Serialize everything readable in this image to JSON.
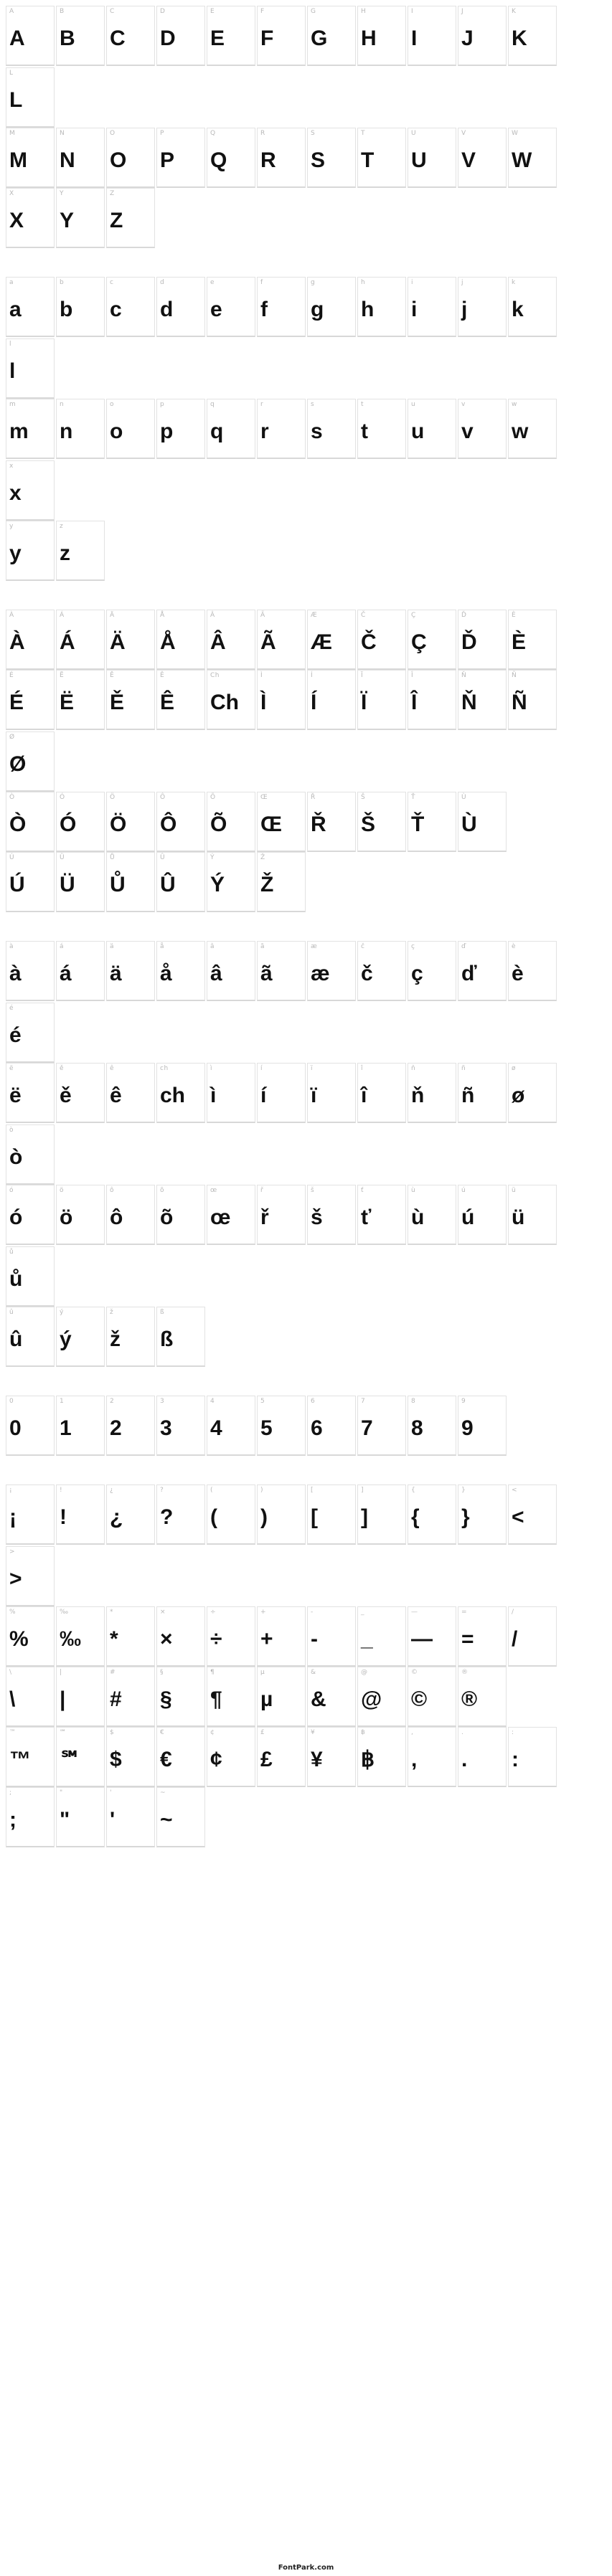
{
  "footer": "FontPark.com",
  "sections": [
    {
      "rows": [
        [
          {
            "lbl": "A",
            "glyph": "A"
          },
          {
            "lbl": "B",
            "glyph": "B"
          },
          {
            "lbl": "C",
            "glyph": "C"
          },
          {
            "lbl": "D",
            "glyph": "D"
          },
          {
            "lbl": "E",
            "glyph": "E"
          },
          {
            "lbl": "F",
            "glyph": "F"
          },
          {
            "lbl": "G",
            "glyph": "G"
          },
          {
            "lbl": "H",
            "glyph": "H"
          },
          {
            "lbl": "I",
            "glyph": "I"
          },
          {
            "lbl": "J",
            "glyph": "J"
          },
          {
            "lbl": "K",
            "glyph": "K"
          },
          {
            "lbl": "L",
            "glyph": "L"
          }
        ],
        [
          {
            "lbl": "M",
            "glyph": "M"
          },
          {
            "lbl": "N",
            "glyph": "N"
          },
          {
            "lbl": "O",
            "glyph": "O"
          },
          {
            "lbl": "P",
            "glyph": "P"
          },
          {
            "lbl": "Q",
            "glyph": "Q"
          },
          {
            "lbl": "R",
            "glyph": "R"
          },
          {
            "lbl": "S",
            "glyph": "S"
          },
          {
            "lbl": "T",
            "glyph": "T"
          },
          {
            "lbl": "U",
            "glyph": "U"
          },
          {
            "lbl": "V",
            "glyph": "V"
          },
          {
            "lbl": "W",
            "glyph": "W"
          }
        ],
        [
          {
            "lbl": "X",
            "glyph": "X"
          },
          {
            "lbl": "Y",
            "glyph": "Y"
          },
          {
            "lbl": "Z",
            "glyph": "Z"
          }
        ]
      ]
    },
    {
      "rows": [
        [
          {
            "lbl": "a",
            "glyph": "a"
          },
          {
            "lbl": "b",
            "glyph": "b"
          },
          {
            "lbl": "c",
            "glyph": "c"
          },
          {
            "lbl": "d",
            "glyph": "d"
          },
          {
            "lbl": "e",
            "glyph": "e"
          },
          {
            "lbl": "f",
            "glyph": "f"
          },
          {
            "lbl": "g",
            "glyph": "g"
          },
          {
            "lbl": "h",
            "glyph": "h"
          },
          {
            "lbl": "i",
            "glyph": "i"
          },
          {
            "lbl": "j",
            "glyph": "j"
          },
          {
            "lbl": "k",
            "glyph": "k"
          },
          {
            "lbl": "l",
            "glyph": "l"
          }
        ],
        [
          {
            "lbl": "m",
            "glyph": "m"
          },
          {
            "lbl": "n",
            "glyph": "n"
          },
          {
            "lbl": "o",
            "glyph": "o"
          },
          {
            "lbl": "p",
            "glyph": "p"
          },
          {
            "lbl": "q",
            "glyph": "q"
          },
          {
            "lbl": "r",
            "glyph": "r"
          },
          {
            "lbl": "s",
            "glyph": "s"
          },
          {
            "lbl": "t",
            "glyph": "t"
          },
          {
            "lbl": "u",
            "glyph": "u"
          },
          {
            "lbl": "v",
            "glyph": "v"
          },
          {
            "lbl": "w",
            "glyph": "w"
          },
          {
            "lbl": "x",
            "glyph": "x"
          }
        ],
        [
          {
            "lbl": "y",
            "glyph": "y"
          },
          {
            "lbl": "z",
            "glyph": "z"
          }
        ]
      ]
    },
    {
      "rows": [
        [
          {
            "lbl": "À",
            "glyph": "À"
          },
          {
            "lbl": "Á",
            "glyph": "Á"
          },
          {
            "lbl": "Ä",
            "glyph": "Ä"
          },
          {
            "lbl": "Å",
            "glyph": "Å"
          },
          {
            "lbl": "Â",
            "glyph": "Â"
          },
          {
            "lbl": "Ã",
            "glyph": "Ã"
          },
          {
            "lbl": "Æ",
            "glyph": "Æ"
          },
          {
            "lbl": "Č",
            "glyph": "Č"
          },
          {
            "lbl": "Ç",
            "glyph": "Ç"
          },
          {
            "lbl": "Ď",
            "glyph": "Ď"
          },
          {
            "lbl": "È",
            "glyph": "È"
          }
        ],
        [
          {
            "lbl": "É",
            "glyph": "É"
          },
          {
            "lbl": "Ë",
            "glyph": "Ë"
          },
          {
            "lbl": "Ě",
            "glyph": "Ě"
          },
          {
            "lbl": "Ê",
            "glyph": "Ê"
          },
          {
            "lbl": "Ch",
            "glyph": "Ch"
          },
          {
            "lbl": "Ì",
            "glyph": "Ì"
          },
          {
            "lbl": "Í",
            "glyph": "Í"
          },
          {
            "lbl": "Ï",
            "glyph": "Ï"
          },
          {
            "lbl": "Î",
            "glyph": "Î"
          },
          {
            "lbl": "Ň",
            "glyph": "Ň"
          },
          {
            "lbl": "Ñ",
            "glyph": "Ñ"
          },
          {
            "lbl": "Ø",
            "glyph": "Ø"
          }
        ],
        [
          {
            "lbl": "Ò",
            "glyph": "Ò"
          },
          {
            "lbl": "Ó",
            "glyph": "Ó"
          },
          {
            "lbl": "Ö",
            "glyph": "Ö"
          },
          {
            "lbl": "Ô",
            "glyph": "Ô"
          },
          {
            "lbl": "Õ",
            "glyph": "Õ"
          },
          {
            "lbl": "Œ",
            "glyph": "Œ"
          },
          {
            "lbl": "Ř",
            "glyph": "Ř"
          },
          {
            "lbl": "Š",
            "glyph": "Š"
          },
          {
            "lbl": "Ť",
            "glyph": "Ť"
          },
          {
            "lbl": "Ù",
            "glyph": "Ù"
          }
        ],
        [
          {
            "lbl": "Ú",
            "glyph": "Ú"
          },
          {
            "lbl": "Ü",
            "glyph": "Ü"
          },
          {
            "lbl": "Ů",
            "glyph": "Ů"
          },
          {
            "lbl": "Û",
            "glyph": "Û"
          },
          {
            "lbl": "Ý",
            "glyph": "Ý"
          },
          {
            "lbl": "Ž",
            "glyph": "Ž"
          }
        ]
      ]
    },
    {
      "rows": [
        [
          {
            "lbl": "à",
            "glyph": "à"
          },
          {
            "lbl": "á",
            "glyph": "á"
          },
          {
            "lbl": "ä",
            "glyph": "ä"
          },
          {
            "lbl": "å",
            "glyph": "å"
          },
          {
            "lbl": "â",
            "glyph": "â"
          },
          {
            "lbl": "ã",
            "glyph": "ã"
          },
          {
            "lbl": "æ",
            "glyph": "æ"
          },
          {
            "lbl": "č",
            "glyph": "č"
          },
          {
            "lbl": "ç",
            "glyph": "ç"
          },
          {
            "lbl": "ď",
            "glyph": "ď"
          },
          {
            "lbl": "è",
            "glyph": "è"
          },
          {
            "lbl": "é",
            "glyph": "é"
          }
        ],
        [
          {
            "lbl": "ë",
            "glyph": "ë"
          },
          {
            "lbl": "ě",
            "glyph": "ě"
          },
          {
            "lbl": "ê",
            "glyph": "ê"
          },
          {
            "lbl": "ch",
            "glyph": "ch"
          },
          {
            "lbl": "ì",
            "glyph": "ì"
          },
          {
            "lbl": "í",
            "glyph": "í"
          },
          {
            "lbl": "ï",
            "glyph": "ï"
          },
          {
            "lbl": "î",
            "glyph": "î"
          },
          {
            "lbl": "ň",
            "glyph": "ň"
          },
          {
            "lbl": "ñ",
            "glyph": "ñ"
          },
          {
            "lbl": "ø",
            "glyph": "ø"
          },
          {
            "lbl": "ò",
            "glyph": "ò"
          }
        ],
        [
          {
            "lbl": "ó",
            "glyph": "ó"
          },
          {
            "lbl": "ö",
            "glyph": "ö"
          },
          {
            "lbl": "ô",
            "glyph": "ô"
          },
          {
            "lbl": "õ",
            "glyph": "õ"
          },
          {
            "lbl": "œ",
            "glyph": "œ"
          },
          {
            "lbl": "ř",
            "glyph": "ř"
          },
          {
            "lbl": "š",
            "glyph": "š"
          },
          {
            "lbl": "ť",
            "glyph": "ť"
          },
          {
            "lbl": "ù",
            "glyph": "ù"
          },
          {
            "lbl": "ú",
            "glyph": "ú"
          },
          {
            "lbl": "ü",
            "glyph": "ü"
          },
          {
            "lbl": "ů",
            "glyph": "ů"
          }
        ],
        [
          {
            "lbl": "û",
            "glyph": "û"
          },
          {
            "lbl": "ý",
            "glyph": "ý"
          },
          {
            "lbl": "ž",
            "glyph": "ž"
          },
          {
            "lbl": "ß",
            "glyph": "ß"
          }
        ]
      ]
    },
    {
      "rows": [
        [
          {
            "lbl": "0",
            "glyph": "0"
          },
          {
            "lbl": "1",
            "glyph": "1"
          },
          {
            "lbl": "2",
            "glyph": "2"
          },
          {
            "lbl": "3",
            "glyph": "3"
          },
          {
            "lbl": "4",
            "glyph": "4"
          },
          {
            "lbl": "5",
            "glyph": "5"
          },
          {
            "lbl": "6",
            "glyph": "6"
          },
          {
            "lbl": "7",
            "glyph": "7"
          },
          {
            "lbl": "8",
            "glyph": "8"
          },
          {
            "lbl": "9",
            "glyph": "9"
          }
        ]
      ]
    },
    {
      "rows": [
        [
          {
            "lbl": "¡",
            "glyph": "¡"
          },
          {
            "lbl": "!",
            "glyph": "!"
          },
          {
            "lbl": "¿",
            "glyph": "¿"
          },
          {
            "lbl": "?",
            "glyph": "?"
          },
          {
            "lbl": "(",
            "glyph": "("
          },
          {
            "lbl": ")",
            "glyph": ")"
          },
          {
            "lbl": "[",
            "glyph": "["
          },
          {
            "lbl": "]",
            "glyph": "]"
          },
          {
            "lbl": "{",
            "glyph": "{"
          },
          {
            "lbl": "}",
            "glyph": "}"
          },
          {
            "lbl": "<",
            "glyph": "<"
          },
          {
            "lbl": ">",
            "glyph": ">"
          }
        ],
        [
          {
            "lbl": "%",
            "glyph": "%"
          },
          {
            "lbl": "‰",
            "glyph": "‰"
          },
          {
            "lbl": "*",
            "glyph": "*"
          },
          {
            "lbl": "×",
            "glyph": "×"
          },
          {
            "lbl": "÷",
            "glyph": "÷"
          },
          {
            "lbl": "+",
            "glyph": "+"
          },
          {
            "lbl": "-",
            "glyph": "-"
          },
          {
            "lbl": "_",
            "glyph": "_"
          },
          {
            "lbl": "—",
            "glyph": "—"
          },
          {
            "lbl": "=",
            "glyph": "="
          },
          {
            "lbl": "/",
            "glyph": "/"
          }
        ],
        [
          {
            "lbl": "\\",
            "glyph": "\\"
          },
          {
            "lbl": "|",
            "glyph": "|"
          },
          {
            "lbl": "#",
            "glyph": "#"
          },
          {
            "lbl": "§",
            "glyph": "§"
          },
          {
            "lbl": "¶",
            "glyph": "¶"
          },
          {
            "lbl": "µ",
            "glyph": "µ"
          },
          {
            "lbl": "&",
            "glyph": "&"
          },
          {
            "lbl": "@",
            "glyph": "@"
          },
          {
            "lbl": "©",
            "glyph": "©"
          },
          {
            "lbl": "®",
            "glyph": "®"
          }
        ],
        [
          {
            "lbl": "™",
            "glyph": "™"
          },
          {
            "lbl": "℠",
            "glyph": "℠"
          },
          {
            "lbl": "$",
            "glyph": "$"
          },
          {
            "lbl": "€",
            "glyph": "€"
          },
          {
            "lbl": "¢",
            "glyph": "¢"
          },
          {
            "lbl": "£",
            "glyph": "£"
          },
          {
            "lbl": "¥",
            "glyph": "¥"
          },
          {
            "lbl": "฿",
            "glyph": "฿"
          },
          {
            "lbl": ",",
            "glyph": ","
          },
          {
            "lbl": ".",
            "glyph": "."
          },
          {
            "lbl": ":",
            "glyph": ":"
          }
        ],
        [
          {
            "lbl": ";",
            "glyph": ";"
          },
          {
            "lbl": "\"",
            "glyph": "\""
          },
          {
            "lbl": "'",
            "glyph": "'"
          },
          {
            "lbl": "~",
            "glyph": "~"
          }
        ]
      ]
    }
  ]
}
